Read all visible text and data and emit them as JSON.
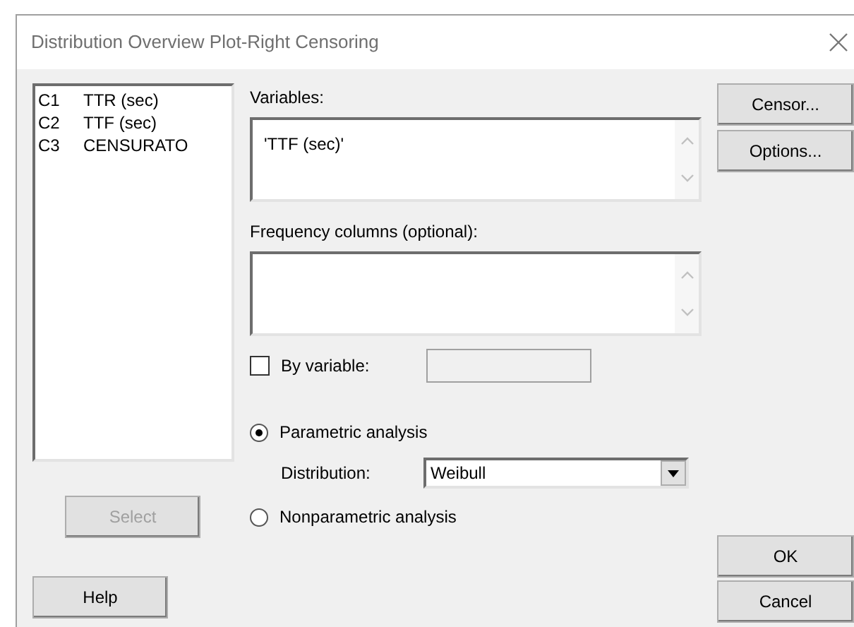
{
  "window": {
    "title": "Distribution Overview Plot-Right Censoring"
  },
  "columns": [
    {
      "id": "C1",
      "name": "TTR (sec)"
    },
    {
      "id": "C2",
      "name": "TTF (sec)"
    },
    {
      "id": "C3",
      "name": "CENSURATO"
    }
  ],
  "variables": {
    "label": "Variables:",
    "value": "'TTF (sec)'"
  },
  "frequency": {
    "label": "Frequency columns (optional):"
  },
  "by_variable": {
    "label": "By variable:",
    "checked": false
  },
  "analysis": [
    {
      "label": "Parametric analysis",
      "selected": true
    },
    {
      "label": "Nonparametric analysis",
      "selected": false
    }
  ],
  "distribution": {
    "label": "Distribution:",
    "value": "Weibull"
  },
  "select_button": {
    "label": "Select",
    "disabled": true
  },
  "help_button": {
    "label": "Help"
  },
  "side_buttons": [
    "Censor...",
    "Options..."
  ],
  "ok_button": {
    "label": "OK"
  },
  "cancel_button": {
    "label": "Cancel"
  }
}
